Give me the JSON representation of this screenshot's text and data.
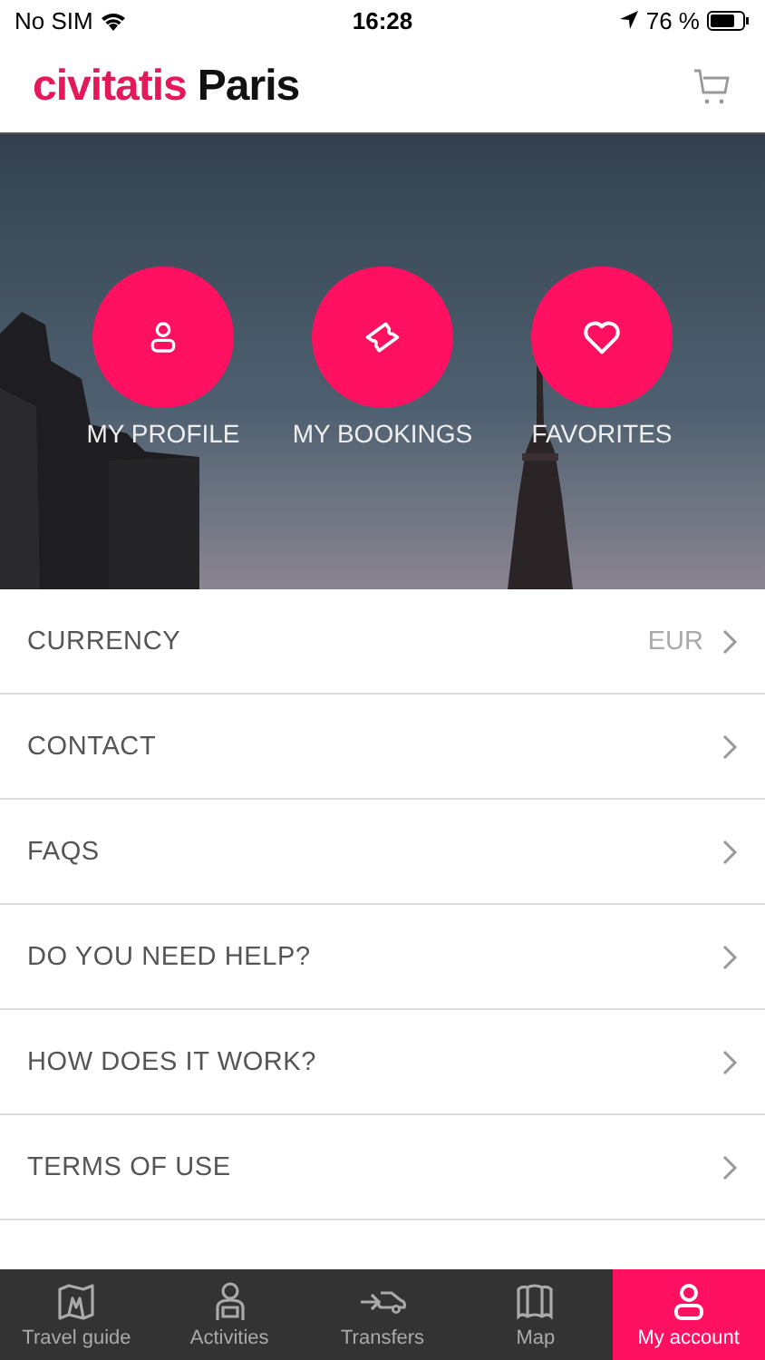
{
  "status_bar": {
    "carrier": "No SIM",
    "time": "16:28",
    "battery": "76 %"
  },
  "header": {
    "brand": "civitatis",
    "city": "Paris"
  },
  "hero": {
    "kind": "picture",
    "actions": [
      {
        "label": "MY PROFILE",
        "kind": "profile"
      },
      {
        "label": "MY BOOKINGS",
        "kind": "ticket"
      },
      {
        "label": "FAVORITES",
        "kind": "heart"
      }
    ]
  },
  "menu": [
    {
      "label": "CURRENCY",
      "value": "EUR"
    },
    {
      "label": "CONTACT"
    },
    {
      "label": "FAQS"
    },
    {
      "label": "DO YOU NEED HELP?"
    },
    {
      "label": "HOW DOES IT WORK?"
    },
    {
      "label": "TERMS OF USE"
    }
  ],
  "tab_bar": [
    {
      "label": "Travel guide",
      "kind": "guide",
      "selected": false
    },
    {
      "label": "Activities",
      "kind": "activities",
      "selected": false
    },
    {
      "label": "Transfers",
      "kind": "transfers",
      "selected": false
    },
    {
      "label": "Map",
      "kind": "map",
      "selected": false
    },
    {
      "label": "My account",
      "kind": "account",
      "selected": true
    }
  ]
}
